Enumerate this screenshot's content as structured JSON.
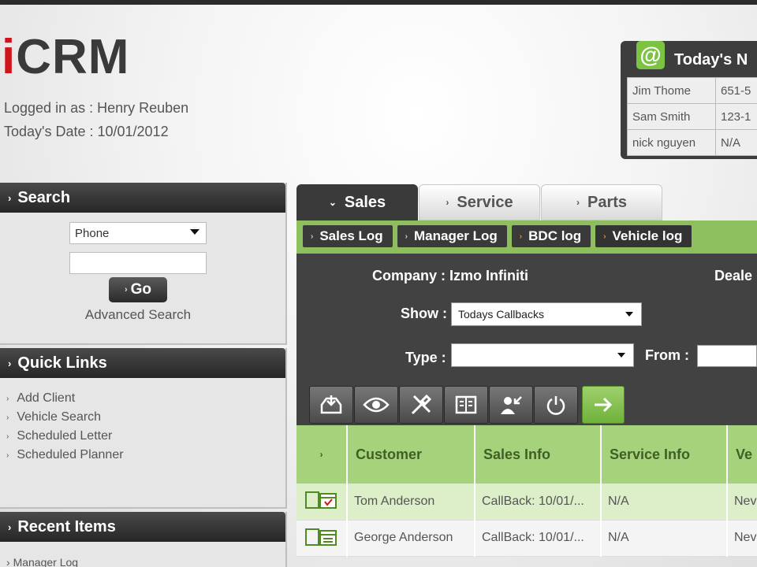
{
  "app": {
    "logo_i": "i",
    "logo_rest": "CRM",
    "logged_in": "Logged in as : Henry Reuben",
    "todays_date": "Today's Date : 10/01/2012"
  },
  "today_widget": {
    "icon": "@",
    "title": "Today's N",
    "rows": [
      {
        "name": "Jim Thome",
        "phone": "651-5"
      },
      {
        "name": "Sam Smith",
        "phone": "123-1"
      },
      {
        "name": "nick nguyen",
        "phone": "N/A"
      }
    ]
  },
  "search": {
    "title": "Search",
    "select_value": "Phone",
    "input_value": "",
    "go_label": "Go",
    "advanced_label": "Advanced Search"
  },
  "quick_links": {
    "title": "Quick Links",
    "items": [
      "Add Client",
      "Vehicle Search",
      "Scheduled Letter",
      "Scheduled Planner"
    ]
  },
  "recent": {
    "title": "Recent Items",
    "first_item": "Manager Log"
  },
  "main_tabs": [
    "Sales",
    "Service",
    "Parts"
  ],
  "sub_tabs": [
    "Sales Log",
    "Manager Log",
    "BDC log",
    "Vehicle log"
  ],
  "form": {
    "company": "Company : Izmo Infiniti",
    "dealer_label": "Deale",
    "show_label": "Show :",
    "show_value": "Todays Callbacks",
    "type_label": "Type :",
    "type_value": "",
    "from_label": "From :"
  },
  "toolbar_icons": [
    "inbox-download-icon",
    "eye-icon",
    "tools-icon",
    "address-book-icon",
    "person-arrow-icon",
    "power-icon",
    "arrow-right-icon"
  ],
  "grid": {
    "sel_header": "›",
    "columns": [
      "Customer",
      "Sales Info",
      "Service Info",
      "Ve"
    ],
    "rows": [
      {
        "customer": "Tom Anderson",
        "sales": "CallBack: 10/01/...",
        "service": "N/A",
        "vehicle": "Nev"
      },
      {
        "customer": "George Anderson",
        "sales": "CallBack: 10/01/...",
        "service": "N/A",
        "vehicle": "Nev"
      }
    ]
  },
  "colors": {
    "brand_red": "#d0141a",
    "accent_green": "#8dbf5e",
    "header_green": "#a6d27b",
    "dark_panel": "#424242"
  }
}
